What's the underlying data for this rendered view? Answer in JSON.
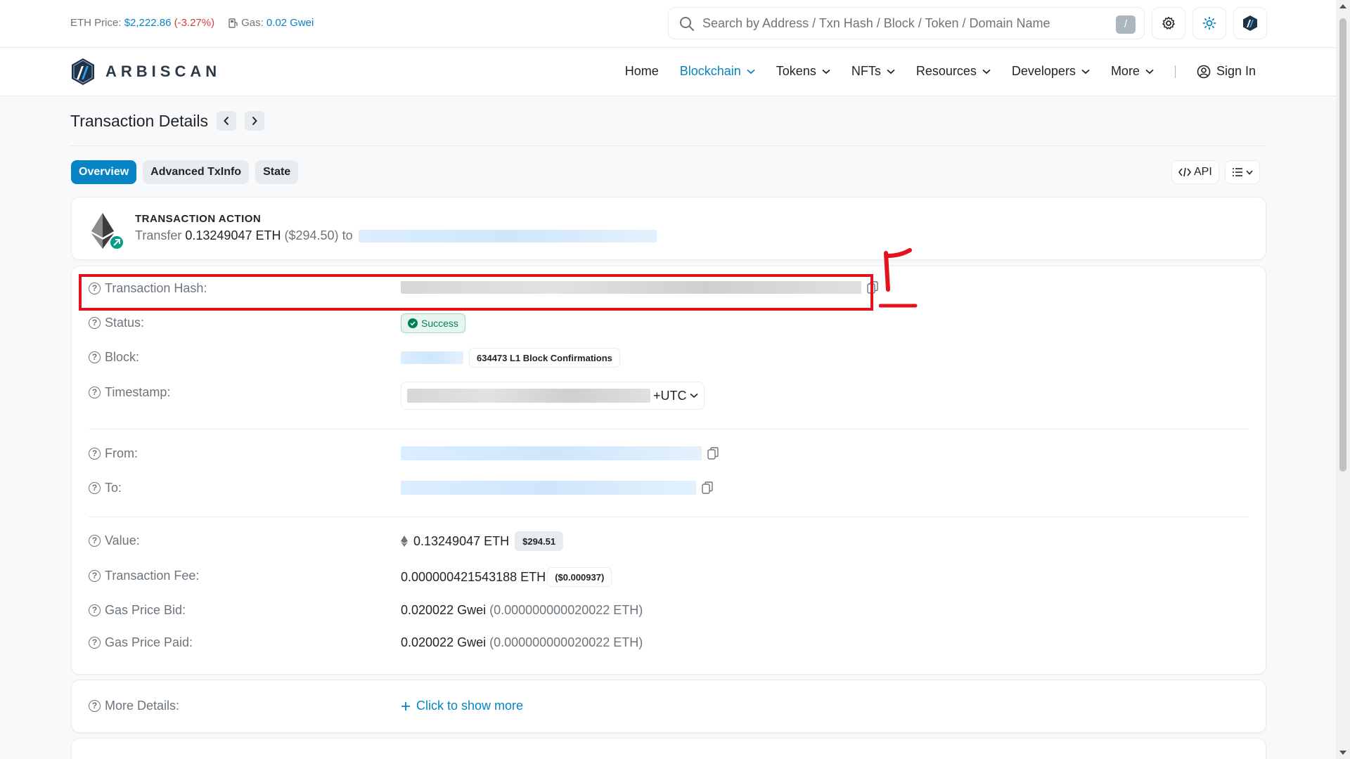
{
  "topbar": {
    "eth_price_label": "ETH Price:",
    "eth_price_value": "$2,222.86",
    "eth_price_change": "(-3.27%)",
    "gas_label": "Gas:",
    "gas_value": "0.02 Gwei",
    "search_placeholder": "Search by Address / Txn Hash / Block / Token / Domain Name",
    "search_shortcut": "/"
  },
  "brand": {
    "name": "ARBISCAN"
  },
  "nav": {
    "items": [
      "Home",
      "Blockchain",
      "Tokens",
      "NFTs",
      "Resources",
      "Developers",
      "More"
    ],
    "active": "Blockchain",
    "sign_in": "Sign In"
  },
  "page": {
    "title": "Transaction Details",
    "tabs": [
      "Overview",
      "Advanced TxInfo",
      "State"
    ],
    "active_tab": "Overview",
    "api_label": "API"
  },
  "action": {
    "title": "TRANSACTION ACTION",
    "verb": "Transfer",
    "amount": "0.13249047 ETH",
    "usd": "($294.50)",
    "to_word": "to"
  },
  "details": {
    "tx_hash_label": "Transaction Hash:",
    "status_label": "Status:",
    "status_value": "Success",
    "block_label": "Block:",
    "block_confirmations": "634473 L1 Block Confirmations",
    "timestamp_label": "Timestamp:",
    "timestamp_tz": "+UTC",
    "from_label": "From:",
    "to_label": "To:",
    "value_label": "Value:",
    "value_amount": "0.13249047 ETH",
    "value_usd": "$294.51",
    "fee_label": "Transaction Fee:",
    "fee_amount": "0.000000421543188 ETH",
    "fee_usd": "($0.000937)",
    "gas_bid_label": "Gas Price Bid:",
    "gas_bid_value": "0.020022 Gwei",
    "gas_bid_eth": "(0.000000000020022 ETH)",
    "gas_paid_label": "Gas Price Paid:",
    "gas_paid_value": "0.020022 Gwei",
    "gas_paid_eth": "(0.000000000020022 ETH)",
    "more_details_label": "More Details:",
    "show_more": "Click to show more"
  },
  "annotation": {
    "mark": "۲",
    "color": "#e3121c"
  },
  "colors": {
    "accent": "#0784c3",
    "success": "#00805a",
    "negative": "#dc3545"
  }
}
